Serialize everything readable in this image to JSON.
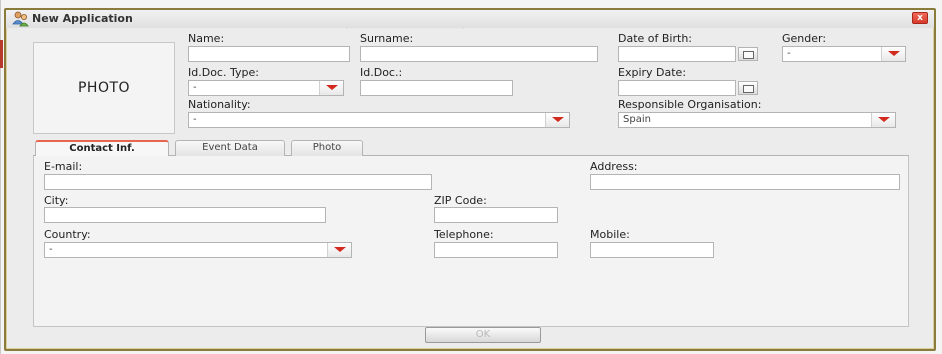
{
  "window": {
    "title": "New Application",
    "close_label": "x",
    "ok_label": "OK"
  },
  "photo_box": {
    "label": "PHOTO"
  },
  "header_fields": {
    "name": {
      "label": "Name:",
      "value": ""
    },
    "surname": {
      "label": "Surname:",
      "value": ""
    },
    "date_of_birth": {
      "label": "Date of Birth:",
      "value": ""
    },
    "gender": {
      "label": "Gender:",
      "value": "-"
    },
    "id_doc_type": {
      "label": "Id.Doc. Type:",
      "value": "-"
    },
    "id_doc": {
      "label": "Id.Doc.:",
      "value": ""
    },
    "expiry_date": {
      "label": "Expiry Date:",
      "value": ""
    },
    "nationality": {
      "label": "Nationality:",
      "value": "-"
    },
    "responsible_org": {
      "label": "Responsible Organisation:",
      "value": "Spain"
    }
  },
  "tabs": [
    {
      "label": "Contact Inf.",
      "active": true
    },
    {
      "label": "Event Data",
      "active": false
    },
    {
      "label": "Photo",
      "active": false
    }
  ],
  "contact": {
    "email": {
      "label": "E-mail:",
      "value": ""
    },
    "address": {
      "label": "Address:",
      "value": ""
    },
    "city": {
      "label": "City:",
      "value": ""
    },
    "zip": {
      "label": "ZIP Code:",
      "value": ""
    },
    "country": {
      "label": "Country:",
      "value": "-"
    },
    "telephone": {
      "label": "Telephone:",
      "value": ""
    },
    "mobile": {
      "label": "Mobile:",
      "value": ""
    }
  },
  "colors": {
    "accent_red": "#d22a1e",
    "window_border": "#8a7a3c",
    "active_tab_top": "#e8664f"
  },
  "icons": {
    "title": "users-icon",
    "dropdown": "chevron-down-icon",
    "date": "calendar-icon",
    "close": "close-icon"
  }
}
